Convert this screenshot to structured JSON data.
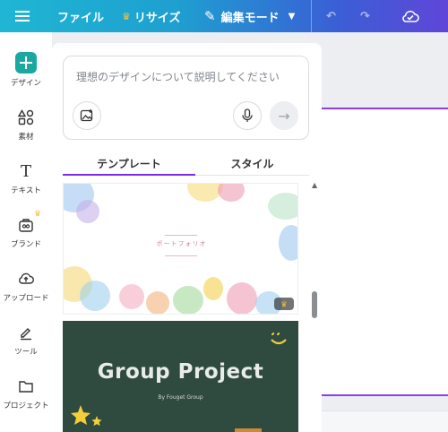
{
  "topbar": {
    "file": "ファイル",
    "resize": "リサイズ",
    "edit_mode": "編集モード"
  },
  "rail": {
    "items": [
      {
        "label": "デザイン",
        "icon": "design-icon"
      },
      {
        "label": "素材",
        "icon": "elements-icon"
      },
      {
        "label": "テキスト",
        "icon": "text-icon"
      },
      {
        "label": "ブランド",
        "icon": "brand-icon"
      },
      {
        "label": "アップロード",
        "icon": "upload-icon"
      },
      {
        "label": "ツール",
        "icon": "tools-icon"
      },
      {
        "label": "プロジェクト",
        "icon": "folder-icon"
      }
    ]
  },
  "panel": {
    "prompt_placeholder": "理想のデザインについて説明してください",
    "tabs": [
      {
        "label": "テンプレート",
        "active": true
      },
      {
        "label": "スタイル",
        "active": false
      }
    ],
    "templates": [
      {
        "title": "ポートフォリオ",
        "premium": true
      },
      {
        "title": "Group Project",
        "subtitle": "By Fouget Group"
      }
    ]
  },
  "colors": {
    "accent": "#7d2ae8",
    "topbar_start": "#1fb6d3",
    "topbar_end": "#5f46d8",
    "premium": "#f7c13c"
  }
}
